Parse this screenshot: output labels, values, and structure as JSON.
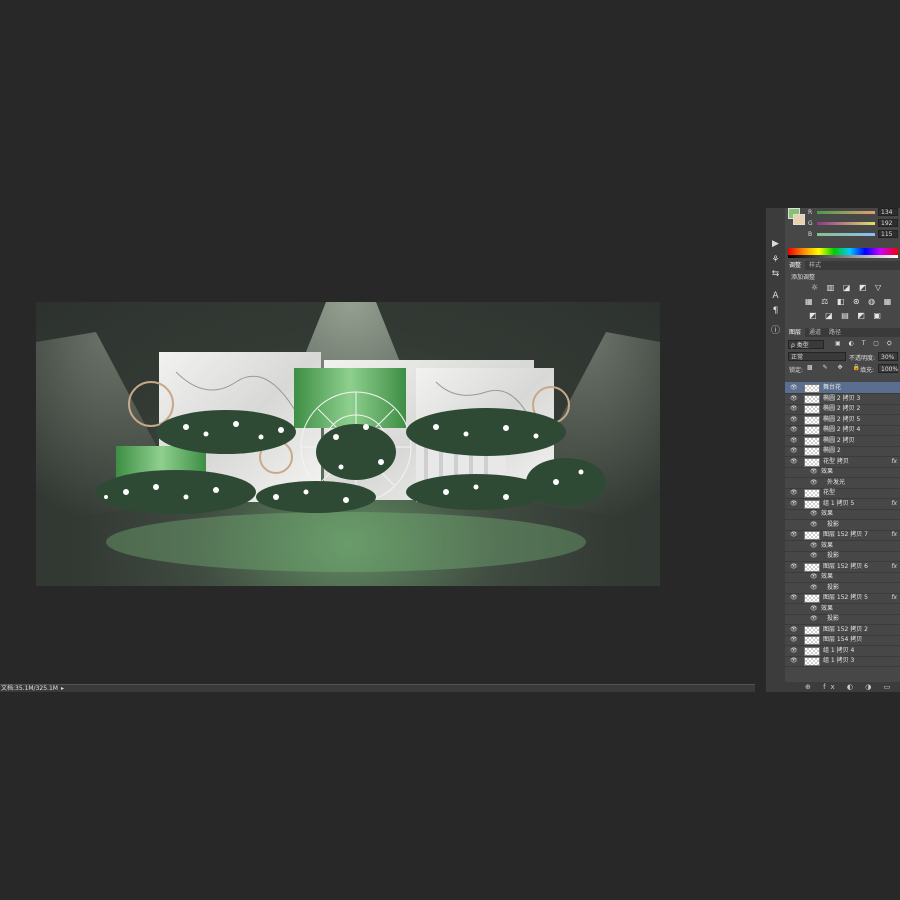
{
  "status": {
    "doc_size": "文档:35.1M/325.1M",
    "arrow": "▸"
  },
  "tools": [
    {
      "icon": "play-icon",
      "glyph": "▶"
    },
    {
      "icon": "brush-settings-icon",
      "glyph": "⚘"
    },
    {
      "icon": "adjust-icon",
      "glyph": "⇆"
    },
    {
      "icon": "character-icon",
      "glyph": "A"
    },
    {
      "icon": "paragraph-icon",
      "glyph": "¶"
    },
    {
      "icon": "info-icon",
      "glyph": "ⓘ"
    }
  ],
  "color_panel": {
    "channels": [
      {
        "label": "R",
        "value": "134",
        "color": "#c88"
      },
      {
        "label": "G",
        "value": "192",
        "color": "#8c8"
      },
      {
        "label": "B",
        "value": "115",
        "color": "#88c"
      }
    ],
    "foreground": "#86c073",
    "background": "#e8d0b0"
  },
  "adjust_panel": {
    "tabs": [
      "调整",
      "样式"
    ],
    "title": "添加调整",
    "row1": "☼ ▥ ◪ ◩ ▽",
    "row2": "▦ ⚖ ◧ ⊛ ◍ ▦",
    "row3": "◩ ◪ ▤ ◩ ▣"
  },
  "layers_panel": {
    "tabs": [
      "图层",
      "通道",
      "路径"
    ],
    "filter_kind": "ρ 类型",
    "blend_mode": "正常",
    "opacity_label": "不透明度:",
    "opacity_value": "30%",
    "lock_label": "锁定:",
    "fill_label": "填充:",
    "fill_value": "100%",
    "layers": [
      {
        "name": "舞台花",
        "type": "layer",
        "selected": true
      },
      {
        "name": "椭圆 2 拷贝 3",
        "type": "layer"
      },
      {
        "name": "椭圆 2 拷贝 2",
        "type": "layer"
      },
      {
        "name": "椭圆 2 拷贝 5",
        "type": "layer"
      },
      {
        "name": "椭圆 2 拷贝 4",
        "type": "layer"
      },
      {
        "name": "椭圆 2 拷贝",
        "type": "layer"
      },
      {
        "name": "椭圆 2",
        "type": "layer"
      },
      {
        "name": "花型 拷贝",
        "type": "layer",
        "fx": "fx"
      },
      {
        "name": "效果",
        "type": "effect"
      },
      {
        "name": "外发光",
        "type": "sub"
      },
      {
        "name": "花型",
        "type": "layer"
      },
      {
        "name": "组 1 拷贝 5",
        "type": "layer",
        "fx": "fx"
      },
      {
        "name": "效果",
        "type": "effect"
      },
      {
        "name": "投影",
        "type": "sub"
      },
      {
        "name": "图层 152 拷贝 7",
        "type": "layer",
        "fx": "fx"
      },
      {
        "name": "效果",
        "type": "effect"
      },
      {
        "name": "投影",
        "type": "sub"
      },
      {
        "name": "图层 152 拷贝 6",
        "type": "layer",
        "fx": "fx"
      },
      {
        "name": "效果",
        "type": "effect"
      },
      {
        "name": "投影",
        "type": "sub"
      },
      {
        "name": "图层 152 拷贝 5",
        "type": "layer",
        "fx": "fx"
      },
      {
        "name": "效果",
        "type": "effect"
      },
      {
        "name": "投影",
        "type": "sub"
      },
      {
        "name": "图层 152 拷贝 2",
        "type": "layer"
      },
      {
        "name": "图层 154 拷贝",
        "type": "layer"
      },
      {
        "name": "组 1 拷贝 4",
        "type": "layer"
      },
      {
        "name": "组 1 拷贝 3",
        "type": "layer"
      }
    ],
    "footer_icons": "⊕ fx ◐ ◑ ▭ ▣ 🗑"
  }
}
